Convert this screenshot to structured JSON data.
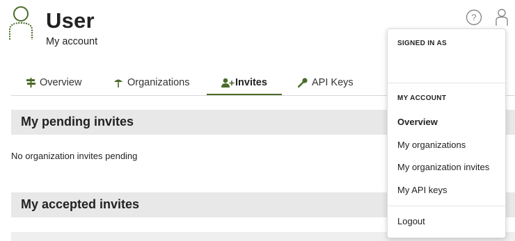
{
  "header": {
    "title": "User",
    "subtitle": "My account",
    "avatar_icon": "user-outline-icon",
    "brand_color": "#4a6b2a"
  },
  "top_icons": {
    "help_icon": "help-circle-icon",
    "user_icon": "user-icon"
  },
  "tabs": [
    {
      "label": "Overview",
      "icon": "signpost-icon",
      "active": false
    },
    {
      "label": "Organizations",
      "icon": "tree-icon",
      "active": false
    },
    {
      "label": "Invites",
      "icon": "user-plus-icon",
      "active": true
    },
    {
      "label": "API Keys",
      "icon": "key-icon",
      "active": false
    }
  ],
  "pending": {
    "heading": "My pending invites",
    "empty_text": "No organization invites pending"
  },
  "accepted": {
    "heading": "My accepted invites"
  },
  "dropdown": {
    "signed_in_label": "SIGNED IN AS",
    "signed_in_value": "",
    "account_label": "MY ACCOUNT",
    "items": [
      {
        "label": "Overview",
        "active": true
      },
      {
        "label": "My organizations",
        "active": false
      },
      {
        "label": "My organization invites",
        "active": false
      },
      {
        "label": "My API keys",
        "active": false
      }
    ],
    "logout_label": "Logout"
  }
}
